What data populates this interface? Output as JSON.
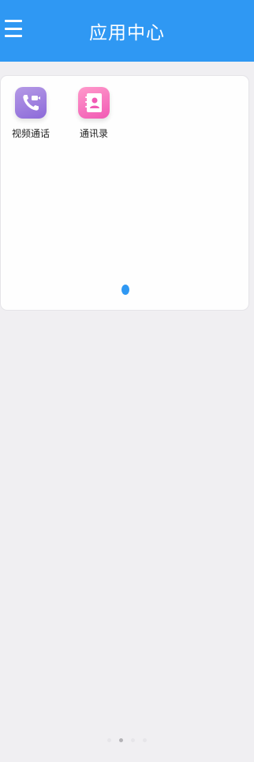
{
  "header": {
    "title": "应用中心",
    "menu_icon": "menu-icon",
    "background": "#2f98f3"
  },
  "apps": [
    {
      "label": "视频通话",
      "icon": "phone-icon",
      "color": "#9c7fe0"
    },
    {
      "label": "通讯录",
      "icon": "contacts-icon",
      "color": "#f672bf"
    }
  ],
  "pager": {
    "pages": 1,
    "current": 1
  },
  "bottom_indicator": {
    "count": 4,
    "active_index": 1
  }
}
